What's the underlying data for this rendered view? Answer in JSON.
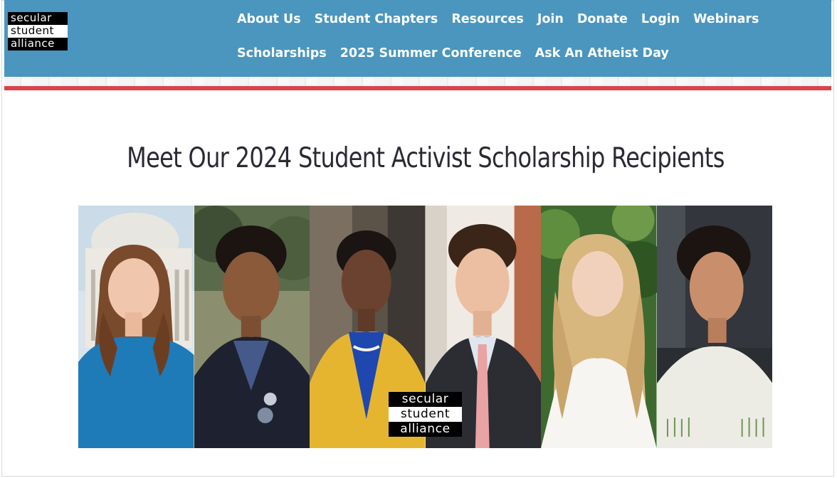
{
  "header": {
    "logo": {
      "line1": "secular",
      "line2": "student",
      "line3": "alliance"
    },
    "nav_row1": [
      "About Us",
      "Student Chapters",
      "Resources",
      "Join",
      "Donate",
      "Login",
      "Webinars"
    ],
    "nav_row2": [
      "Scholarships",
      "2025 Summer Conference",
      "Ask An Atheist Day"
    ]
  },
  "colors": {
    "header_bg": "#4a96bf",
    "accent_red": "#d9444b",
    "title_text": "#2a2a33"
  },
  "main": {
    "title": "Meet Our 2024 Student Activist Scholarship Recipients",
    "photo_logo": {
      "line1": "secular",
      "line2": "student",
      "line3": "alliance"
    }
  }
}
